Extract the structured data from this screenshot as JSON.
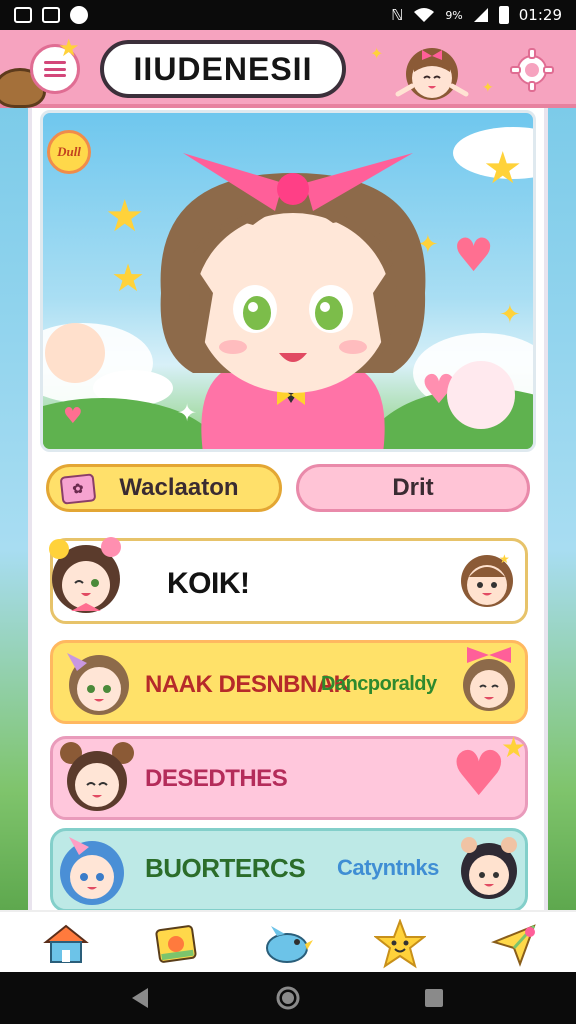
{
  "status_bar": {
    "left_icons": [
      "image-icon",
      "notification-icon",
      "sync-icon"
    ],
    "right_icons": [
      "nfc-icon",
      "wifi-icon",
      "signal-icon",
      "battery-icon"
    ],
    "battery_text": "9%",
    "time": "01:29"
  },
  "header": {
    "title": "IIUDENESII",
    "menu_icon": "hamburger-icon",
    "settings_icon": "gear-icon"
  },
  "hero": {
    "badge_text": "Dull"
  },
  "actions": {
    "primary_label": "Waclaaton",
    "primary_ticket_text": "🎫",
    "secondary_label": "Drit"
  },
  "list": [
    {
      "label": "KOIK!",
      "sub": ""
    },
    {
      "label": "NAAK DESNBNAK",
      "sub": "Dancporaldy"
    },
    {
      "label": "DESEDTHES",
      "sub": ""
    },
    {
      "label": "BUORTERCS",
      "sub": "Catyntnks"
    }
  ],
  "bottom_nav": [
    {
      "icon": "house-icon"
    },
    {
      "icon": "picture-card-icon"
    },
    {
      "icon": "bird-icon"
    },
    {
      "icon": "star-face-icon"
    },
    {
      "icon": "paper-plane-icon"
    }
  ],
  "system_nav": {
    "back_icon": "back-triangle-icon",
    "home_icon": "home-circle-icon",
    "recents_icon": "recents-square-icon"
  },
  "colors": {
    "header_pink": "#f6a3bf",
    "primary_yellow": "#ffe06a",
    "secondary_pink": "#ffc4d6",
    "row_yellow": "#ffe169",
    "row_pink": "#ffc7dc",
    "row_teal": "#bde9e6"
  }
}
